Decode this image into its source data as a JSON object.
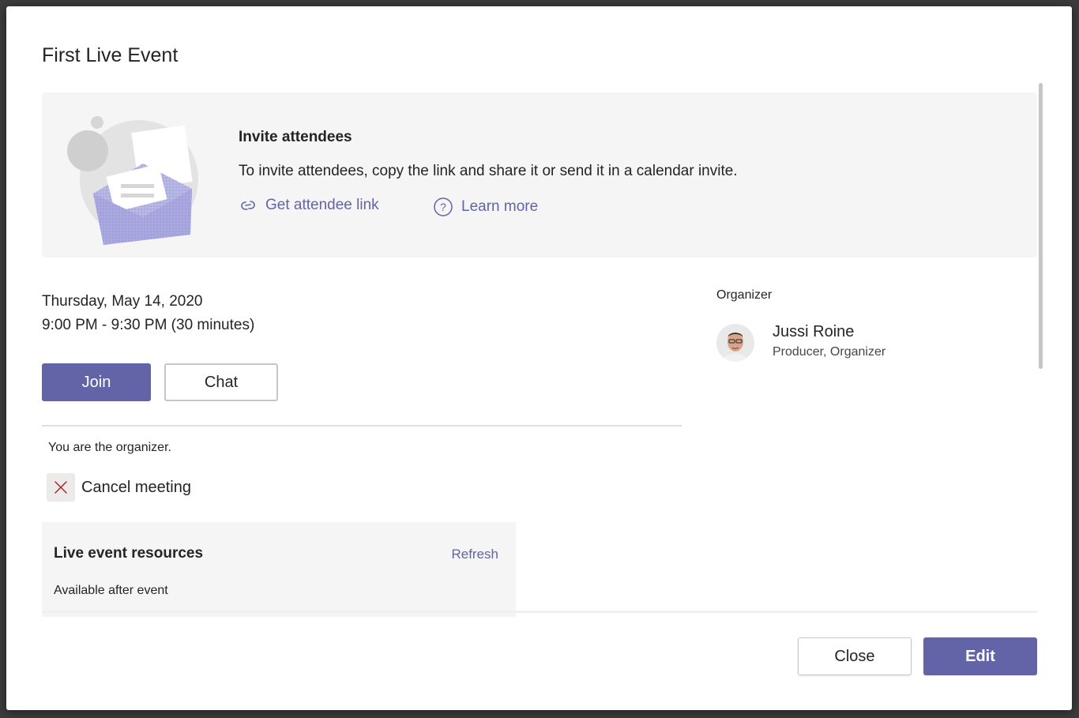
{
  "dialog": {
    "title": "First Live Event"
  },
  "invite": {
    "heading": "Invite attendees",
    "description": "To invite attendees, copy the link and share it or send it in a calendar invite.",
    "get_link_label": "Get attendee link",
    "learn_more_label": "Learn more"
  },
  "event": {
    "date": "Thursday, May 14, 2020",
    "time": "9:00 PM - 9:30 PM (30 minutes)",
    "join_label": "Join",
    "chat_label": "Chat",
    "organizer_note": "You are the organizer.",
    "cancel_label": "Cancel meeting"
  },
  "resources": {
    "title": "Live event resources",
    "refresh_label": "Refresh",
    "status": "Available after event"
  },
  "organizer": {
    "section_label": "Organizer",
    "name": "Jussi Roine",
    "role": "Producer, Organizer"
  },
  "footer": {
    "close_label": "Close",
    "edit_label": "Edit"
  },
  "colors": {
    "accent": "#6264a7",
    "text": "#252423",
    "banner_bg": "#f5f5f5"
  },
  "icons": {
    "link": "link-icon",
    "help": "help-circle-icon",
    "cancel": "close-x-icon"
  }
}
